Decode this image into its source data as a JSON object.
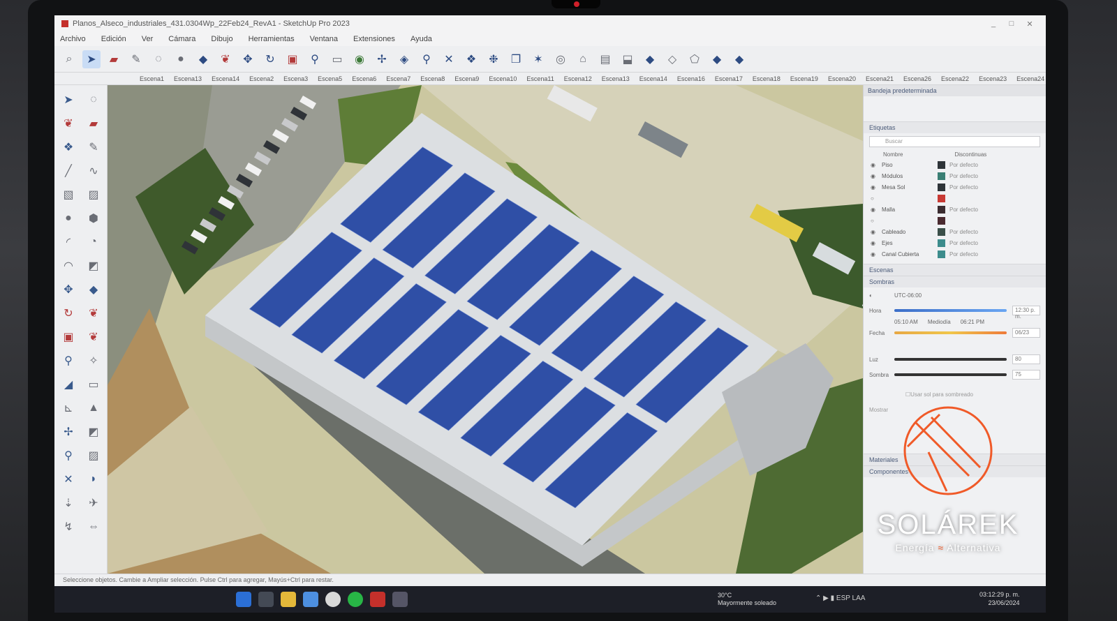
{
  "window": {
    "title": "Planos_Alseco_industriales_431.0304Wp_22Feb24_RevA1 - SketchUp Pro 2023",
    "minimize": "_",
    "maximize": "□",
    "close": "✕"
  },
  "menu": [
    "Archivo",
    "Edición",
    "Ver",
    "Cámara",
    "Dibujo",
    "Herramientas",
    "Ventana",
    "Extensiones",
    "Ayuda"
  ],
  "toolbar_icons": [
    "search-icon",
    "select-icon",
    "eraser-icon",
    "pencil-icon",
    "lasso-icon",
    "sphere-icon",
    "push-pull-icon",
    "paint-icon",
    "move-icon",
    "rotate-icon",
    "scale-icon",
    "tape-icon",
    "text-icon",
    "follow-icon",
    "orbit-icon",
    "section-icon",
    "zoom-icon",
    "extents-icon",
    "component-icon",
    "group-icon",
    "layers-icon",
    "solid-icon",
    "user-icon",
    "house-icon",
    "store-icon",
    "view-icon"
  ],
  "scenes": [
    "Escena1",
    "Escena13",
    "Escena14",
    "Escena2",
    "Escena3",
    "Escena5",
    "Escena6",
    "Escena7",
    "Escena8",
    "Escena9",
    "Escena10",
    "Escena11",
    "Escena12",
    "Escena13",
    "Escena14",
    "Escena16",
    "Escena17",
    "Escena18",
    "Escena19",
    "Escena20",
    "Escena21",
    "Escena26",
    "Escena22",
    "Escena23",
    "Escena24"
  ],
  "tray": {
    "title": "Bandeja predeterminada",
    "tags_section": "Etiquetas",
    "search_placeholder": "Buscar",
    "col_name": "Nombre",
    "col_dashes": "Discontinuas",
    "tags": [
      {
        "name": "Piso",
        "color": "#2e3438",
        "dashes": "Por defecto"
      },
      {
        "name": "Módulos",
        "color": "#3a7f74",
        "dashes": "Por defecto"
      },
      {
        "name": "Mesa Sol",
        "color": "#2e3438",
        "dashes": "Por defecto"
      },
      {
        "name": "",
        "color": "#c83a34",
        "dashes": ""
      },
      {
        "name": "Malla",
        "color": "#3a2c30",
        "dashes": "Por defecto"
      },
      {
        "name": "",
        "color": "#4a2a30",
        "dashes": ""
      },
      {
        "name": "Cableado",
        "color": "#3a4f49",
        "dashes": "Por defecto"
      },
      {
        "name": "Ejes",
        "color": "#3c8c8c",
        "dashes": "Por defecto"
      },
      {
        "name": "Canal Cubierta",
        "color": "#3c8c8c",
        "dashes": "Por defecto"
      }
    ],
    "scenes_section": "Escenas",
    "shadows_section": "Sombras",
    "utc": "UTC-06:00",
    "time_label": "Hora",
    "time_start": "05:10 AM",
    "time_mid": "Mediodía",
    "time_end": "06:21 PM",
    "time_value": "12:30 p. m.",
    "date_label": "Fecha",
    "date_value": "06/23",
    "light_label": "Luz",
    "light_value": "80",
    "dark_label": "Sombra",
    "dark_value": "75",
    "use_sun_label": "Usar sol para sombreado",
    "display_label": "Mostrar",
    "sections": [
      "Materiales",
      "Componentes"
    ]
  },
  "status": "Seleccione objetos. Cambie a Ampliar selección. Pulse Ctrl para agregar, Mayús+Ctrl para restar.",
  "taskbar": {
    "weather_temp": "30°C",
    "weather_text": "Mayormente soleado",
    "lang": "ESP LAA",
    "time": "03:12:29 p. m.",
    "date": "23/06/2024"
  },
  "brand": {
    "name": "SOLÁREK",
    "tag_left": "Energía",
    "tag_wave": "≈",
    "tag_right": "Alternativa",
    "accent": "#f05a28"
  },
  "colors": {
    "panel": "#2f4fa6",
    "roof": "#dcdfe2",
    "grass": "#5f7d3a",
    "ground": "#c9c59d"
  }
}
